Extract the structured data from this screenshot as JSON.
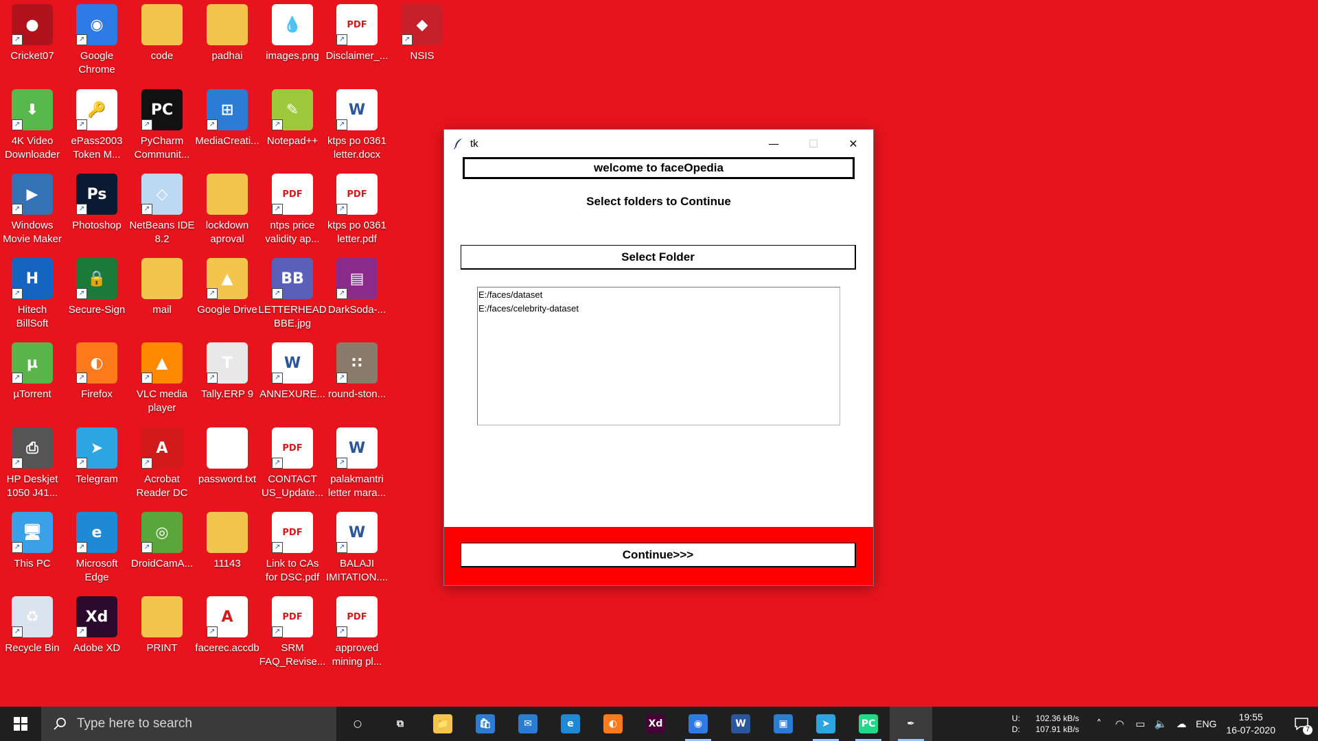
{
  "desktop": {
    "icons": [
      {
        "label": "Cricket07",
        "icon": "cricket-ball-icon",
        "color": "#b1131d",
        "glyph": "●"
      },
      {
        "label": "Google\nChrome",
        "icon": "chrome-icon",
        "color": "#2f7be5",
        "glyph": "◉"
      },
      {
        "label": "code",
        "icon": "folder-icon",
        "color": "#f4c54c",
        "glyph": ""
      },
      {
        "label": "padhai",
        "icon": "folder-icon",
        "color": "#f4c54c",
        "glyph": ""
      },
      {
        "label": "images.png",
        "icon": "image-file-icon",
        "color": "#ffffff",
        "glyph": "💧"
      },
      {
        "label": "Disclaimer_...",
        "icon": "pdf-icon",
        "color": "#ffffff",
        "glyph": "PDF"
      },
      {
        "label": "NSIS",
        "icon": "nsis-icon",
        "color": "#c8202a",
        "glyph": "◆"
      },
      {
        "label": "4K Video\nDownloader",
        "icon": "4k-downloader-icon",
        "color": "#57b94b",
        "glyph": "⬇"
      },
      {
        "label": "ePass2003\nToken M...",
        "icon": "epass-icon",
        "color": "#ffffff",
        "glyph": "🔑"
      },
      {
        "label": "PyCharm\nCommunit...",
        "icon": "pycharm-icon",
        "color": "#111111",
        "glyph": "PC"
      },
      {
        "label": "MediaCreati...",
        "icon": "media-creation-icon",
        "color": "#2b7cd3",
        "glyph": "⊞"
      },
      {
        "label": "Notepad++",
        "icon": "notepadpp-icon",
        "color": "#9ec93c",
        "glyph": "✎"
      },
      {
        "label": "ktps po 0361\nletter.docx",
        "icon": "word-doc-icon",
        "color": "#ffffff",
        "glyph": "W"
      },
      {
        "label": "Windows\nMovie Maker",
        "icon": "movie-maker-icon",
        "color": "#3572b5",
        "glyph": "▶"
      },
      {
        "label": "Photoshop",
        "icon": "photoshop-icon",
        "color": "#0b1a33",
        "glyph": "Ps"
      },
      {
        "label": "NetBeans IDE\n8.2",
        "icon": "netbeans-icon",
        "color": "#bcd9f2",
        "glyph": "◇"
      },
      {
        "label": "lockdown\naproval",
        "icon": "folder-icon",
        "color": "#f4c54c",
        "glyph": ""
      },
      {
        "label": "ntps price\nvalidity ap...",
        "icon": "pdf-icon",
        "color": "#ffffff",
        "glyph": "PDF"
      },
      {
        "label": "ktps po 0361\nletter.pdf",
        "icon": "pdf-icon",
        "color": "#ffffff",
        "glyph": "PDF"
      },
      {
        "label": "Hitech\nBillSoft",
        "icon": "billsoft-icon",
        "color": "#1565c0",
        "glyph": "H"
      },
      {
        "label": "Secure-Sign",
        "icon": "secure-sign-icon",
        "color": "#1b7a3a",
        "glyph": "🔒"
      },
      {
        "label": "mail",
        "icon": "folder-icon",
        "color": "#f4c54c",
        "glyph": ""
      },
      {
        "label": "Google Drive",
        "icon": "google-drive-icon",
        "color": "#f4c54c",
        "glyph": "▲"
      },
      {
        "label": "LETTERHEAD\nBBE.jpg",
        "icon": "image-file-icon",
        "color": "#5a5fb8",
        "glyph": "BB"
      },
      {
        "label": "DarkSoda-...",
        "icon": "winrar-icon",
        "color": "#8b2c8c",
        "glyph": "▤"
      },
      {
        "label": "µTorrent",
        "icon": "utorrent-icon",
        "color": "#59b44a",
        "glyph": "µ"
      },
      {
        "label": "Firefox",
        "icon": "firefox-icon",
        "color": "#ff7a1a",
        "glyph": "◐"
      },
      {
        "label": "VLC media\nplayer",
        "icon": "vlc-icon",
        "color": "#ff8a00",
        "glyph": "▲"
      },
      {
        "label": "Tally.ERP 9",
        "icon": "tally-icon",
        "color": "#e8e8e8",
        "glyph": "T"
      },
      {
        "label": "ANNEXURE...",
        "icon": "word-doc-icon",
        "color": "#ffffff",
        "glyph": "W"
      },
      {
        "label": "round-ston...",
        "icon": "image-file-icon",
        "color": "#8a7a6a",
        "glyph": "∷"
      },
      {
        "label": "HP Deskjet\n1050 J41...",
        "icon": "printer-icon",
        "color": "#555555",
        "glyph": "⎙"
      },
      {
        "label": "Telegram",
        "icon": "telegram-icon",
        "color": "#2ca5e0",
        "glyph": "➤"
      },
      {
        "label": "Acrobat\nReader DC",
        "icon": "acrobat-icon",
        "color": "#d21a1a",
        "glyph": "A"
      },
      {
        "label": "password.txt",
        "icon": "text-file-icon",
        "color": "#ffffff",
        "glyph": ""
      },
      {
        "label": "CONTACT\nUS_Update...",
        "icon": "pdf-icon",
        "color": "#ffffff",
        "glyph": "PDF"
      },
      {
        "label": "palakmantri\nletter mara...",
        "icon": "word-doc-icon",
        "color": "#ffffff",
        "glyph": "W"
      },
      {
        "label": "This PC",
        "icon": "this-pc-icon",
        "color": "#3aa0e8",
        "glyph": "🖥"
      },
      {
        "label": "Microsoft\nEdge",
        "icon": "edge-icon",
        "color": "#1e8ad6",
        "glyph": "e"
      },
      {
        "label": "DroidCamA...",
        "icon": "droidcam-icon",
        "color": "#5aa63a",
        "glyph": "◎"
      },
      {
        "label": "11143",
        "icon": "folder-icon",
        "color": "#f4c54c",
        "glyph": ""
      },
      {
        "label": "Link to CAs\nfor DSC.pdf",
        "icon": "pdf-icon",
        "color": "#ffffff",
        "glyph": "PDF"
      },
      {
        "label": "BALAJI\nIMITATION....",
        "icon": "word-doc-icon",
        "color": "#ffffff",
        "glyph": "W"
      },
      {
        "label": "Recycle Bin",
        "icon": "recycle-bin-icon",
        "color": "#d9e4ee",
        "glyph": "♻"
      },
      {
        "label": "Adobe XD",
        "icon": "adobe-xd-icon",
        "color": "#2b0a2e",
        "glyph": "Xd"
      },
      {
        "label": "PRINT",
        "icon": "folder-icon",
        "color": "#f4c54c",
        "glyph": ""
      },
      {
        "label": "facerec.accdb",
        "icon": "access-file-icon",
        "color": "#ffffff",
        "glyph": "A"
      },
      {
        "label": "SRM\nFAQ_Revise...",
        "icon": "pdf-icon",
        "color": "#ffffff",
        "glyph": "PDF"
      },
      {
        "label": "approved\nmining pl...",
        "icon": "pdf-icon",
        "color": "#ffffff",
        "glyph": "PDF"
      }
    ]
  },
  "window": {
    "title": "tk",
    "header": "welcome to faceOpedia",
    "subtitle": "Select folders to Continue",
    "select_button": "Select Folder",
    "folders": [
      "E:/faces/dataset",
      "E:/faces/celebrity-dataset"
    ],
    "continue_button": "Continue>>>"
  },
  "taskbar": {
    "search_placeholder": "Type here to search",
    "apps": [
      {
        "name": "cortana",
        "icon": "cortana-icon",
        "glyph": "○",
        "color": "transparent",
        "running": false
      },
      {
        "name": "task-view",
        "icon": "task-view-icon",
        "glyph": "⧉",
        "color": "transparent",
        "running": false
      },
      {
        "name": "file-explorer",
        "icon": "file-explorer-icon",
        "glyph": "📁",
        "color": "#f4c54c",
        "running": false
      },
      {
        "name": "store",
        "icon": "store-icon",
        "glyph": "🛍",
        "color": "#2b7cd3",
        "running": false
      },
      {
        "name": "mail",
        "icon": "mail-icon",
        "glyph": "✉",
        "color": "#2b7cd3",
        "running": false
      },
      {
        "name": "ie",
        "icon": "internet-explorer-icon",
        "glyph": "e",
        "color": "#1e8ad6",
        "running": false
      },
      {
        "name": "firefox",
        "icon": "firefox-icon",
        "glyph": "◐",
        "color": "#ff7a1a",
        "running": false
      },
      {
        "name": "adobe-xd",
        "icon": "adobe-xd-icon",
        "glyph": "Xd",
        "color": "#470137",
        "running": false
      },
      {
        "name": "chrome",
        "icon": "chrome-icon",
        "glyph": "◉",
        "color": "#2f7be5",
        "running": true
      },
      {
        "name": "word",
        "icon": "word-icon",
        "glyph": "W",
        "color": "#2b579a",
        "running": false
      },
      {
        "name": "capture",
        "icon": "snip-icon",
        "glyph": "▣",
        "color": "#2b7cd3",
        "running": false
      },
      {
        "name": "telegram",
        "icon": "telegram-icon",
        "glyph": "➤",
        "color": "#2ca5e0",
        "running": true
      },
      {
        "name": "pycharm",
        "icon": "pycharm-icon",
        "glyph": "PC",
        "color": "#21d789",
        "running": true
      },
      {
        "name": "python-tk",
        "icon": "python-feather-icon",
        "glyph": "✒",
        "color": "#3b3b3b",
        "running": true
      }
    ],
    "net": {
      "up_label": "U:",
      "up": "102.36 kB/s",
      "down_label": "D:",
      "down": "107.91 kB/s"
    },
    "lang": "ENG",
    "time": "19:55",
    "date": "16-07-2020",
    "notifications": "7"
  }
}
